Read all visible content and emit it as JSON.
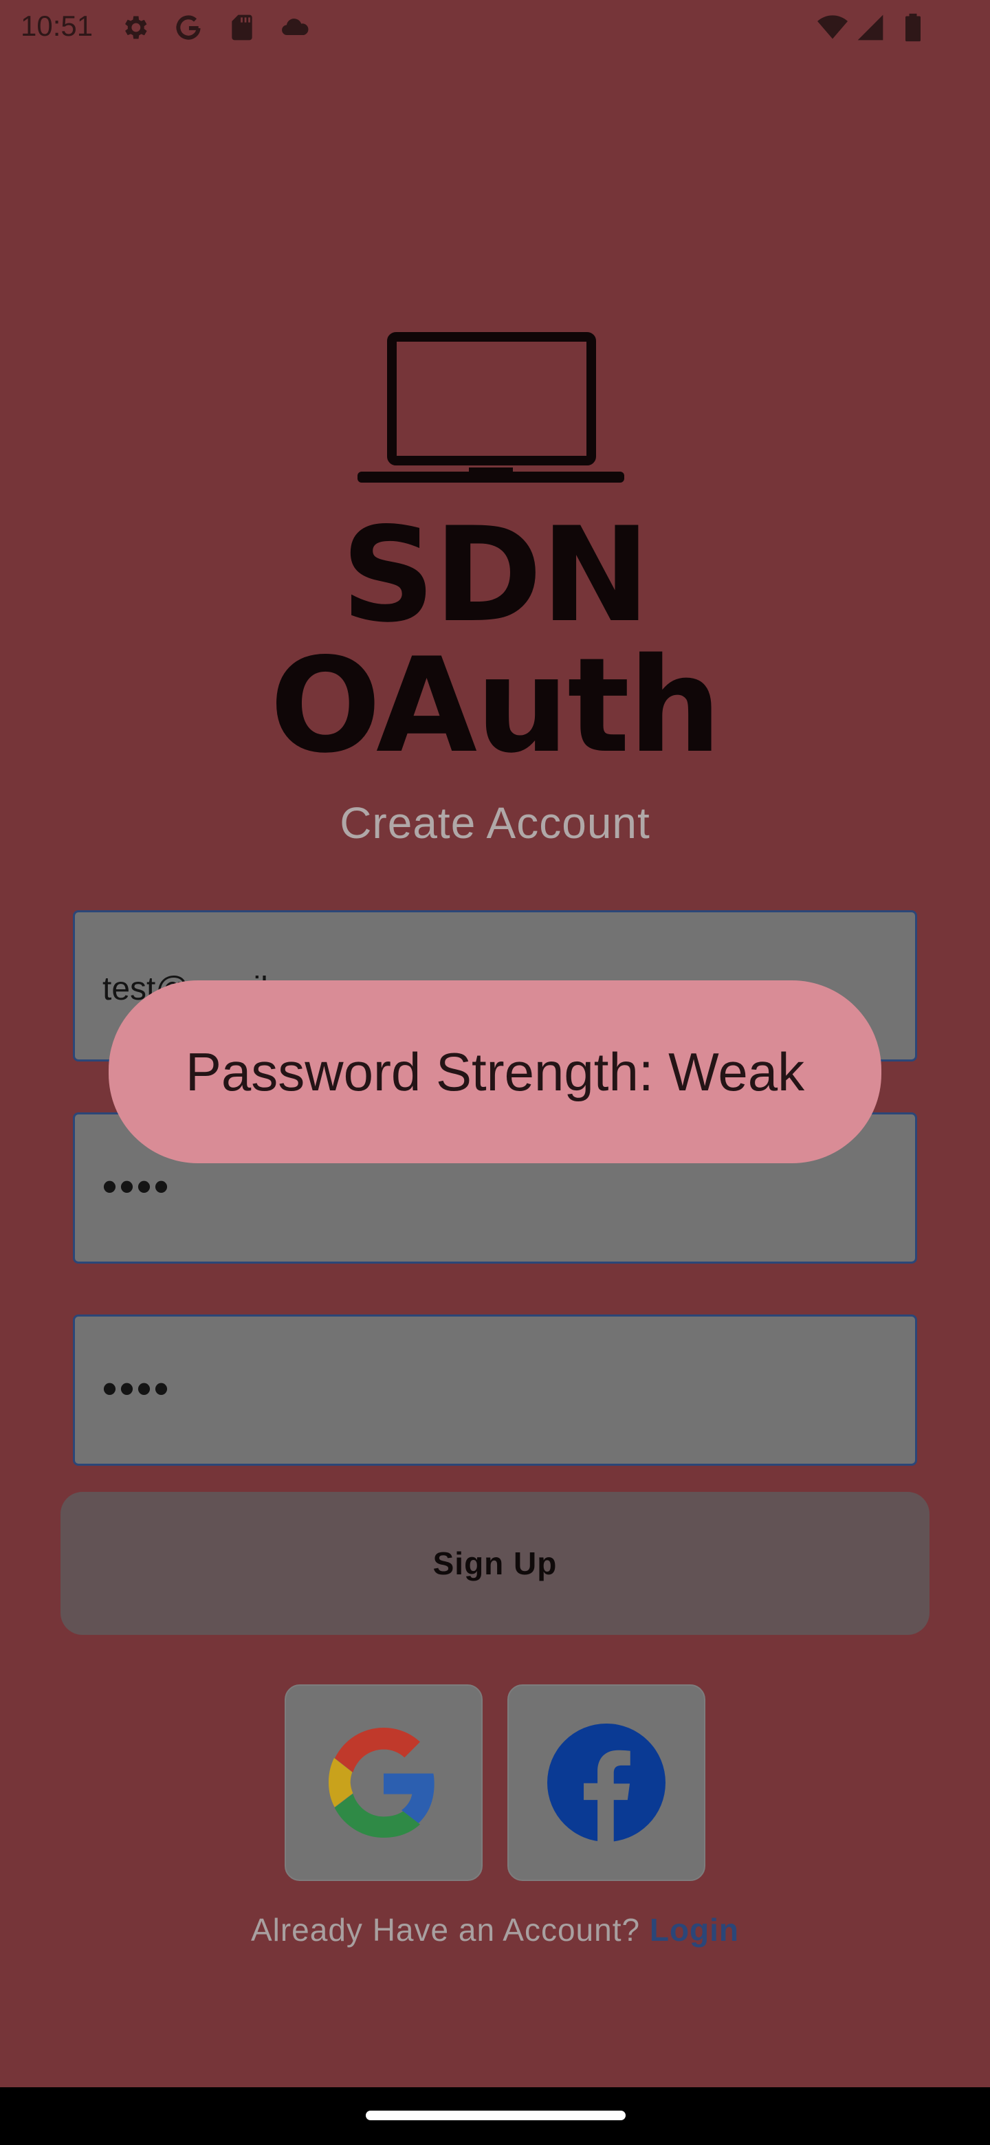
{
  "status_bar": {
    "time": "10:51",
    "left_icons": [
      "gear-icon",
      "google-g-icon",
      "sd-card-icon",
      "cloud-icon"
    ],
    "right_icons": [
      "wifi-icon",
      "signal-icon",
      "battery-icon"
    ]
  },
  "logo": {
    "icon": "laptop-icon",
    "text": "SDN OAuth"
  },
  "heading": "Create Account",
  "form": {
    "email_value": "test@gmail.com",
    "password_value": "••••",
    "confirm_password_value": "••••"
  },
  "signup_button": {
    "label": "Sign Up"
  },
  "social": [
    {
      "name": "google-login-button",
      "icon": "google-icon"
    },
    {
      "name": "facebook-login-button",
      "icon": "facebook-icon"
    }
  ],
  "login_prompt": {
    "text": "Already Have an Account?",
    "link": "Login"
  },
  "toast": {
    "text": "Password Strength: Weak"
  },
  "colors": {
    "background": "#763539",
    "field_border": "#2b4678",
    "toast_background": "#d98c96",
    "link": "#2b4678"
  }
}
